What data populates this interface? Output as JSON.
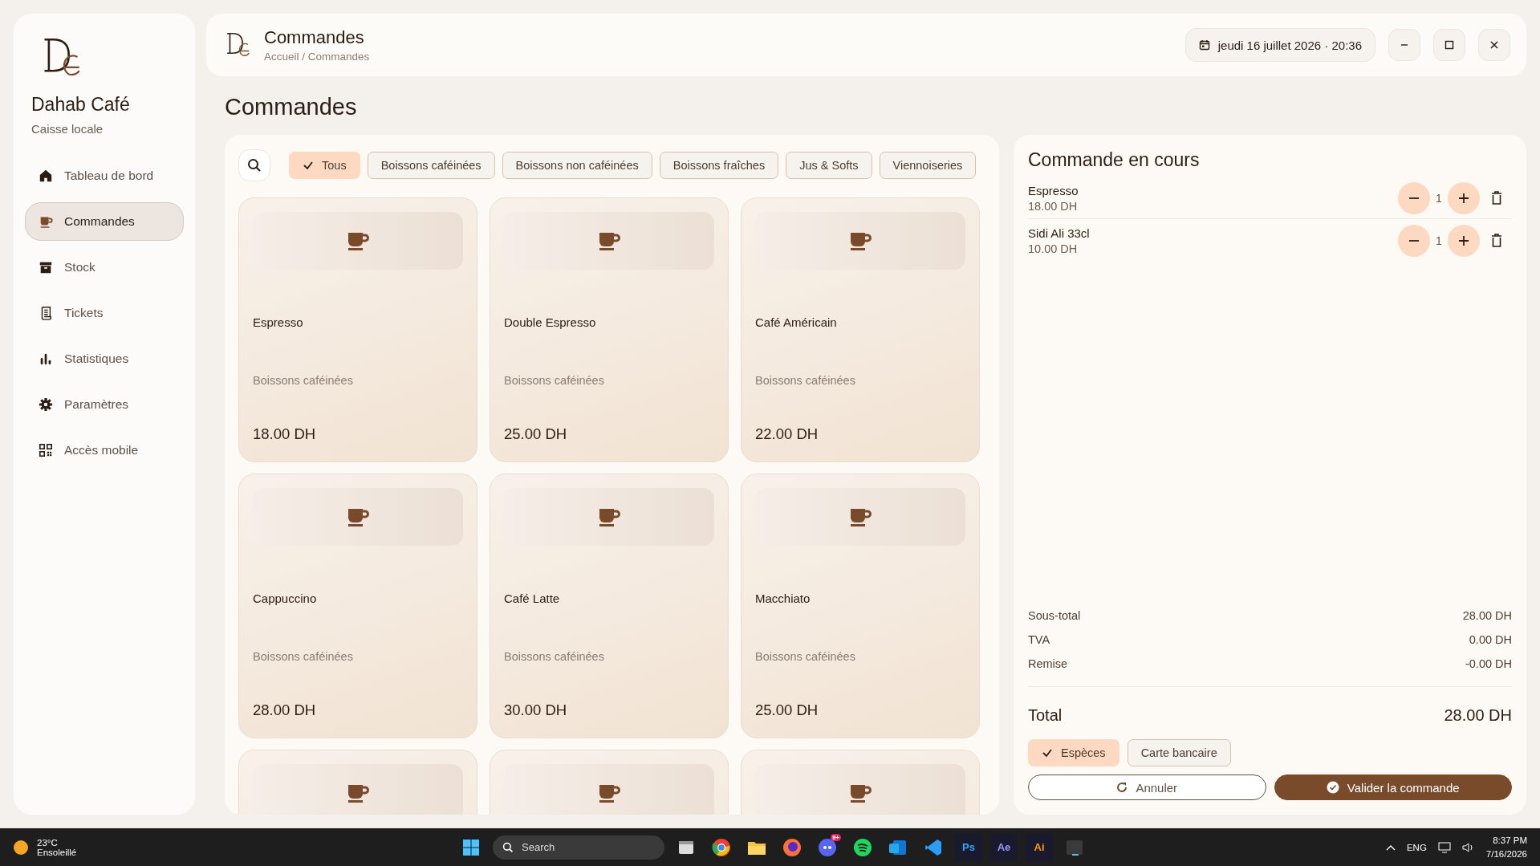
{
  "sidebar": {
    "brand": "Dahab Café",
    "subtitle": "Caisse locale",
    "items": [
      {
        "label": "Tableau de bord",
        "selected": false
      },
      {
        "label": "Commandes",
        "selected": true
      },
      {
        "label": "Stock",
        "selected": false
      },
      {
        "label": "Tickets",
        "selected": false
      },
      {
        "label": "Statistiques",
        "selected": false
      },
      {
        "label": "Paramètres",
        "selected": false
      },
      {
        "label": "Accès mobile",
        "selected": false
      }
    ]
  },
  "header": {
    "title": "Commandes",
    "breadcrumb": "Accueil / Commandes",
    "datetime": "jeudi 16 juillet 2026 · 20:36"
  },
  "page_title": "Commandes",
  "filters": [
    {
      "label": "Tous",
      "selected": true
    },
    {
      "label": "Boissons caféinées",
      "selected": false
    },
    {
      "label": "Boissons non caféinées",
      "selected": false
    },
    {
      "label": "Boissons fraîches",
      "selected": false
    },
    {
      "label": "Jus & Softs",
      "selected": false
    },
    {
      "label": "Viennoiseries",
      "selected": false
    }
  ],
  "products": [
    {
      "kind": "full",
      "name": "Espresso",
      "category": "Boissons caféinées",
      "price": "18.00 DH"
    },
    {
      "kind": "full",
      "name": "Double Espresso",
      "category": "Boissons caféinées",
      "price": "25.00 DH"
    },
    {
      "kind": "full",
      "name": "Café Américain",
      "category": "Boissons caféinées",
      "price": "22.00 DH"
    },
    {
      "kind": "full",
      "name": "Cappuccino",
      "category": "Boissons caféinées",
      "price": "28.00 DH"
    },
    {
      "kind": "full",
      "name": "Café Latte",
      "category": "Boissons caféinées",
      "price": "30.00 DH"
    },
    {
      "kind": "full",
      "name": "Macchiato",
      "category": "Boissons caféinées",
      "price": "25.00 DH"
    },
    {
      "kind": "cut"
    },
    {
      "kind": "cut"
    },
    {
      "kind": "cut"
    }
  ],
  "order": {
    "title": "Commande en cours",
    "lines": [
      {
        "name": "Espresso",
        "price": "18.00 DH",
        "qty": "1"
      },
      {
        "name": "Sidi Ali 33cl",
        "price": "10.00 DH",
        "qty": "1"
      }
    ],
    "summary": [
      {
        "label": "Sous-total",
        "value": "28.00 DH"
      },
      {
        "label": "TVA",
        "value": "0.00 DH"
      },
      {
        "label": "Remise",
        "value": "-0.00 DH"
      }
    ],
    "total": {
      "label": "Total",
      "value": "28.00 DH"
    },
    "payments": [
      {
        "label": "Espèces",
        "selected": true
      },
      {
        "label": "Carte bancaire",
        "selected": false
      }
    ],
    "cancel": "Annuler",
    "confirm": "Valider la commande"
  },
  "taskbar": {
    "temperature": "23°C",
    "weather": "Ensoleillé",
    "search": "Search",
    "apps": [
      {
        "kind": "windows"
      },
      {
        "kind": "files"
      },
      {
        "kind": "chrome"
      },
      {
        "kind": "folder"
      },
      {
        "kind": "firefox"
      },
      {
        "kind": "discord",
        "badge": "9+"
      },
      {
        "kind": "spotify"
      },
      {
        "kind": "mail"
      },
      {
        "kind": "vscode"
      },
      {
        "kind": "text",
        "label": "Ps",
        "color": "#31a8ff"
      },
      {
        "kind": "text",
        "label": "Ae",
        "color": "#9999ff"
      },
      {
        "kind": "text",
        "label": "Ai",
        "color": "#ff9a00"
      },
      {
        "kind": "terminal"
      }
    ],
    "language": "ENG",
    "time": "8:37 PM",
    "date": "7/16/2026"
  }
}
